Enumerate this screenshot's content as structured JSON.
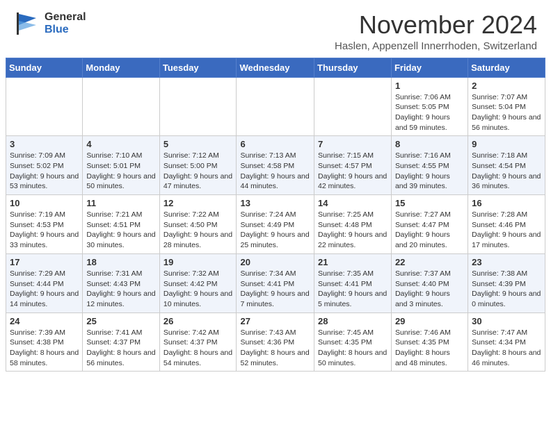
{
  "header": {
    "logo_general": "General",
    "logo_blue": "Blue",
    "month_title": "November 2024",
    "subtitle": "Haslen, Appenzell Innerrhoden, Switzerland"
  },
  "days_of_week": [
    "Sunday",
    "Monday",
    "Tuesday",
    "Wednesday",
    "Thursday",
    "Friday",
    "Saturday"
  ],
  "weeks": [
    [
      {
        "day": "",
        "info": ""
      },
      {
        "day": "",
        "info": ""
      },
      {
        "day": "",
        "info": ""
      },
      {
        "day": "",
        "info": ""
      },
      {
        "day": "",
        "info": ""
      },
      {
        "day": "1",
        "info": "Sunrise: 7:06 AM\nSunset: 5:05 PM\nDaylight: 9 hours and 59 minutes."
      },
      {
        "day": "2",
        "info": "Sunrise: 7:07 AM\nSunset: 5:04 PM\nDaylight: 9 hours and 56 minutes."
      }
    ],
    [
      {
        "day": "3",
        "info": "Sunrise: 7:09 AM\nSunset: 5:02 PM\nDaylight: 9 hours and 53 minutes."
      },
      {
        "day": "4",
        "info": "Sunrise: 7:10 AM\nSunset: 5:01 PM\nDaylight: 9 hours and 50 minutes."
      },
      {
        "day": "5",
        "info": "Sunrise: 7:12 AM\nSunset: 5:00 PM\nDaylight: 9 hours and 47 minutes."
      },
      {
        "day": "6",
        "info": "Sunrise: 7:13 AM\nSunset: 4:58 PM\nDaylight: 9 hours and 44 minutes."
      },
      {
        "day": "7",
        "info": "Sunrise: 7:15 AM\nSunset: 4:57 PM\nDaylight: 9 hours and 42 minutes."
      },
      {
        "day": "8",
        "info": "Sunrise: 7:16 AM\nSunset: 4:55 PM\nDaylight: 9 hours and 39 minutes."
      },
      {
        "day": "9",
        "info": "Sunrise: 7:18 AM\nSunset: 4:54 PM\nDaylight: 9 hours and 36 minutes."
      }
    ],
    [
      {
        "day": "10",
        "info": "Sunrise: 7:19 AM\nSunset: 4:53 PM\nDaylight: 9 hours and 33 minutes."
      },
      {
        "day": "11",
        "info": "Sunrise: 7:21 AM\nSunset: 4:51 PM\nDaylight: 9 hours and 30 minutes."
      },
      {
        "day": "12",
        "info": "Sunrise: 7:22 AM\nSunset: 4:50 PM\nDaylight: 9 hours and 28 minutes."
      },
      {
        "day": "13",
        "info": "Sunrise: 7:24 AM\nSunset: 4:49 PM\nDaylight: 9 hours and 25 minutes."
      },
      {
        "day": "14",
        "info": "Sunrise: 7:25 AM\nSunset: 4:48 PM\nDaylight: 9 hours and 22 minutes."
      },
      {
        "day": "15",
        "info": "Sunrise: 7:27 AM\nSunset: 4:47 PM\nDaylight: 9 hours and 20 minutes."
      },
      {
        "day": "16",
        "info": "Sunrise: 7:28 AM\nSunset: 4:46 PM\nDaylight: 9 hours and 17 minutes."
      }
    ],
    [
      {
        "day": "17",
        "info": "Sunrise: 7:29 AM\nSunset: 4:44 PM\nDaylight: 9 hours and 14 minutes."
      },
      {
        "day": "18",
        "info": "Sunrise: 7:31 AM\nSunset: 4:43 PM\nDaylight: 9 hours and 12 minutes."
      },
      {
        "day": "19",
        "info": "Sunrise: 7:32 AM\nSunset: 4:42 PM\nDaylight: 9 hours and 10 minutes."
      },
      {
        "day": "20",
        "info": "Sunrise: 7:34 AM\nSunset: 4:41 PM\nDaylight: 9 hours and 7 minutes."
      },
      {
        "day": "21",
        "info": "Sunrise: 7:35 AM\nSunset: 4:41 PM\nDaylight: 9 hours and 5 minutes."
      },
      {
        "day": "22",
        "info": "Sunrise: 7:37 AM\nSunset: 4:40 PM\nDaylight: 9 hours and 3 minutes."
      },
      {
        "day": "23",
        "info": "Sunrise: 7:38 AM\nSunset: 4:39 PM\nDaylight: 9 hours and 0 minutes."
      }
    ],
    [
      {
        "day": "24",
        "info": "Sunrise: 7:39 AM\nSunset: 4:38 PM\nDaylight: 8 hours and 58 minutes."
      },
      {
        "day": "25",
        "info": "Sunrise: 7:41 AM\nSunset: 4:37 PM\nDaylight: 8 hours and 56 minutes."
      },
      {
        "day": "26",
        "info": "Sunrise: 7:42 AM\nSunset: 4:37 PM\nDaylight: 8 hours and 54 minutes."
      },
      {
        "day": "27",
        "info": "Sunrise: 7:43 AM\nSunset: 4:36 PM\nDaylight: 8 hours and 52 minutes."
      },
      {
        "day": "28",
        "info": "Sunrise: 7:45 AM\nSunset: 4:35 PM\nDaylight: 8 hours and 50 minutes."
      },
      {
        "day": "29",
        "info": "Sunrise: 7:46 AM\nSunset: 4:35 PM\nDaylight: 8 hours and 48 minutes."
      },
      {
        "day": "30",
        "info": "Sunrise: 7:47 AM\nSunset: 4:34 PM\nDaylight: 8 hours and 46 minutes."
      }
    ]
  ]
}
